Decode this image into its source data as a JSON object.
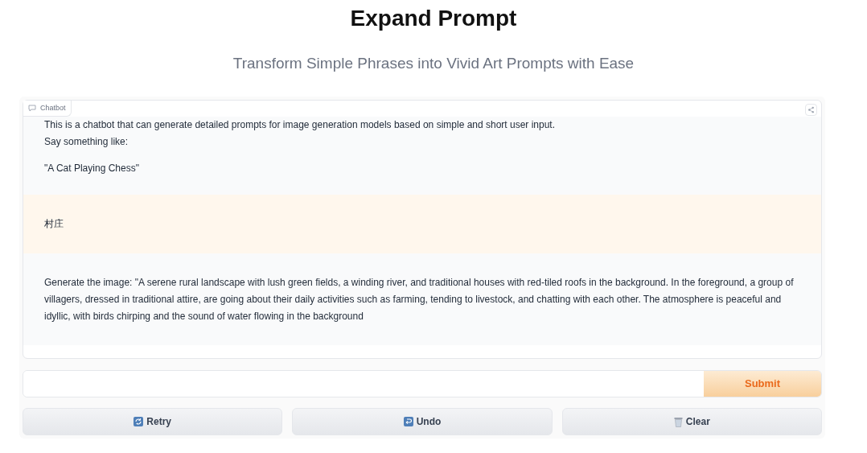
{
  "title": "Expand Prompt",
  "subtitle": "Transform Simple Phrases into Vivid Art Prompts with Ease",
  "chatbot": {
    "label": "Chatbot",
    "messages": [
      {
        "kind": "bot",
        "paragraphs": [
          [
            "This is a chatbot that can generate detailed prompts for image generation models based on simple and short user input.",
            "Say something like:"
          ],
          [
            "\"A Cat Playing Chess\""
          ]
        ]
      },
      {
        "kind": "user",
        "paragraphs": [
          [
            "村庄"
          ]
        ]
      },
      {
        "kind": "bot",
        "paragraphs": [
          [
            "Generate the image: \"A serene rural landscape with lush green fields, a winding river, and traditional houses with red-tiled roofs in the background. In the foreground, a group of villagers, dressed in traditional attire, are going about their daily activities such as farming, tending to livestock, and chatting with each other. The atmosphere is peaceful and idyllic, with birds chirping and the sound of water flowing in the background"
          ]
        ]
      }
    ]
  },
  "submit": "Submit",
  "buttons": [
    {
      "kind": "retry",
      "label": "Retry"
    },
    {
      "kind": "undo",
      "label": "Undo"
    },
    {
      "kind": "clear",
      "label": "Clear"
    }
  ]
}
